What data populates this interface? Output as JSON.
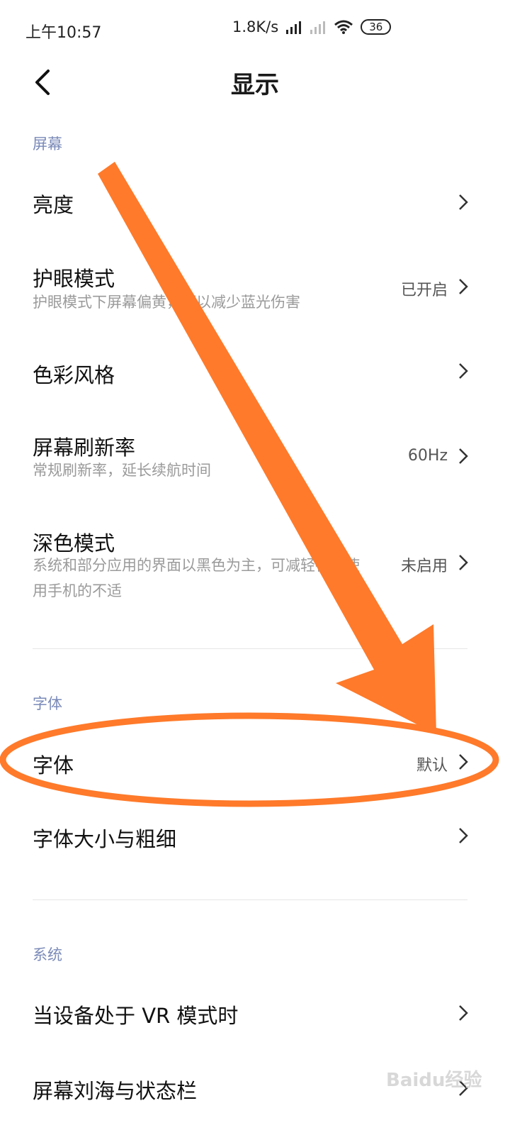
{
  "status_bar": {
    "time": "上午10:57",
    "speed": "1.8K/s",
    "battery": "36"
  },
  "header": {
    "title": "显示"
  },
  "sections": {
    "screen": {
      "label": "屏幕"
    },
    "font": {
      "label": "字体"
    },
    "system": {
      "label": "系统"
    }
  },
  "items": {
    "brightness": {
      "title": "亮度"
    },
    "eye_care": {
      "title": "护眼模式",
      "subtitle": "护眼模式下屏幕偏黄，可以减少蓝光伤害",
      "value": "已开启"
    },
    "color_style": {
      "title": "色彩风格"
    },
    "refresh_rate": {
      "title": "屏幕刷新率",
      "subtitle": "常规刷新率，延长续航时间",
      "value": "60Hz"
    },
    "dark_mode": {
      "title": "深色模式",
      "subtitle": "系统和部分应用的界面以黑色为主，可减轻夜间使用手机的不适",
      "value": "未启用"
    },
    "font": {
      "title": "字体",
      "value": "默认"
    },
    "font_size": {
      "title": "字体大小与粗细"
    },
    "vr_mode": {
      "title": "当设备处于 VR 模式时"
    },
    "notch": {
      "title": "屏幕刘海与状态栏"
    }
  },
  "colors": {
    "accent_section": "#7a8ab8",
    "annotation_orange": "#ff7a2a"
  },
  "watermark": {
    "text": "Baidu经验"
  }
}
